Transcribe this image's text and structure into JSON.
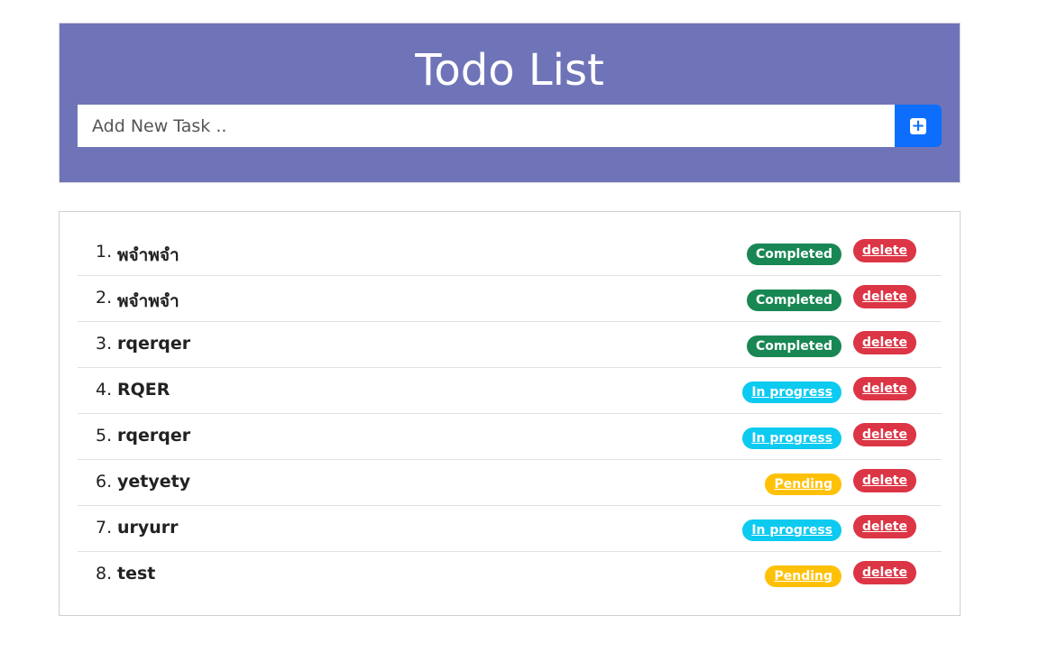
{
  "header": {
    "title": "Todo List",
    "input_placeholder": "Add New Task ..",
    "input_value": "",
    "add_icon": "plus-square-icon",
    "bg_color": "#6f74b8"
  },
  "tasks": [
    {
      "number": "1.",
      "name": "พจำพจำ",
      "status": "Completed",
      "status_type": "completed",
      "delete_label": "delete"
    },
    {
      "number": "2.",
      "name": "พจำพจำ",
      "status": "Completed",
      "status_type": "completed",
      "delete_label": "delete"
    },
    {
      "number": "3.",
      "name": "rqerqer",
      "status": "Completed",
      "status_type": "completed",
      "delete_label": "delete"
    },
    {
      "number": "4.",
      "name": "RQER",
      "status": "In progress",
      "status_type": "progress",
      "delete_label": "delete"
    },
    {
      "number": "5.",
      "name": "rqerqer",
      "status": "In progress",
      "status_type": "progress",
      "delete_label": "delete"
    },
    {
      "number": "6.",
      "name": "yetyety",
      "status": "Pending",
      "status_type": "pending",
      "delete_label": "delete"
    },
    {
      "number": "7.",
      "name": "uryurr",
      "status": "In progress",
      "status_type": "progress",
      "delete_label": "delete"
    },
    {
      "number": "8.",
      "name": "test",
      "status": "Pending",
      "status_type": "pending",
      "delete_label": "delete"
    }
  ],
  "colors": {
    "completed": "#198754",
    "progress": "#0dcaf0",
    "pending": "#ffc107",
    "delete": "#dc3545",
    "add_button": "#0d6efd"
  }
}
